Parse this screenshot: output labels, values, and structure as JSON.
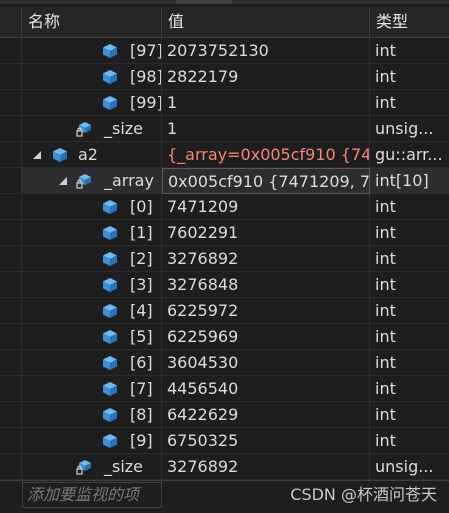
{
  "header": {
    "name_label": "名称",
    "value_label": "值",
    "type_label": "类型"
  },
  "rows": [
    {
      "name": "[97]",
      "value": "2073752130",
      "type": "int"
    },
    {
      "name": "[98]",
      "value": "2822179",
      "type": "int"
    },
    {
      "name": "[99]",
      "value": "1",
      "type": "int"
    },
    {
      "name": "_size",
      "value": "1",
      "type": "unsig..."
    },
    {
      "name": "a2",
      "value": "{_array=0x005cf910 {74...",
      "type": "gu::arr..."
    },
    {
      "name": "_array",
      "value": "0x005cf910 {7471209, 7...",
      "type": "int[10]"
    },
    {
      "name": "[0]",
      "value": "7471209",
      "type": "int"
    },
    {
      "name": "[1]",
      "value": "7602291",
      "type": "int"
    },
    {
      "name": "[2]",
      "value": "3276892",
      "type": "int"
    },
    {
      "name": "[3]",
      "value": "3276848",
      "type": "int"
    },
    {
      "name": "[4]",
      "value": "6225972",
      "type": "int"
    },
    {
      "name": "[5]",
      "value": "6225969",
      "type": "int"
    },
    {
      "name": "[6]",
      "value": "3604530",
      "type": "int"
    },
    {
      "name": "[7]",
      "value": "4456540",
      "type": "int"
    },
    {
      "name": "[8]",
      "value": "6422629",
      "type": "int"
    },
    {
      "name": "[9]",
      "value": "6750325",
      "type": "int"
    },
    {
      "name": "_size",
      "value": "3276892",
      "type": "unsig..."
    }
  ],
  "footer": {
    "add_watch_placeholder": "添加要监视的项",
    "watermark": "CSDN @杯酒问苍天"
  },
  "colors": {
    "background": "#1e1e1e",
    "changed_value": "#f48771",
    "icon_blue": "#4ea6ea"
  },
  "icons": {
    "field": "field-cube-icon",
    "private_field": "private-field-cube-icon",
    "expanded": "expanded-triangle-icon"
  }
}
